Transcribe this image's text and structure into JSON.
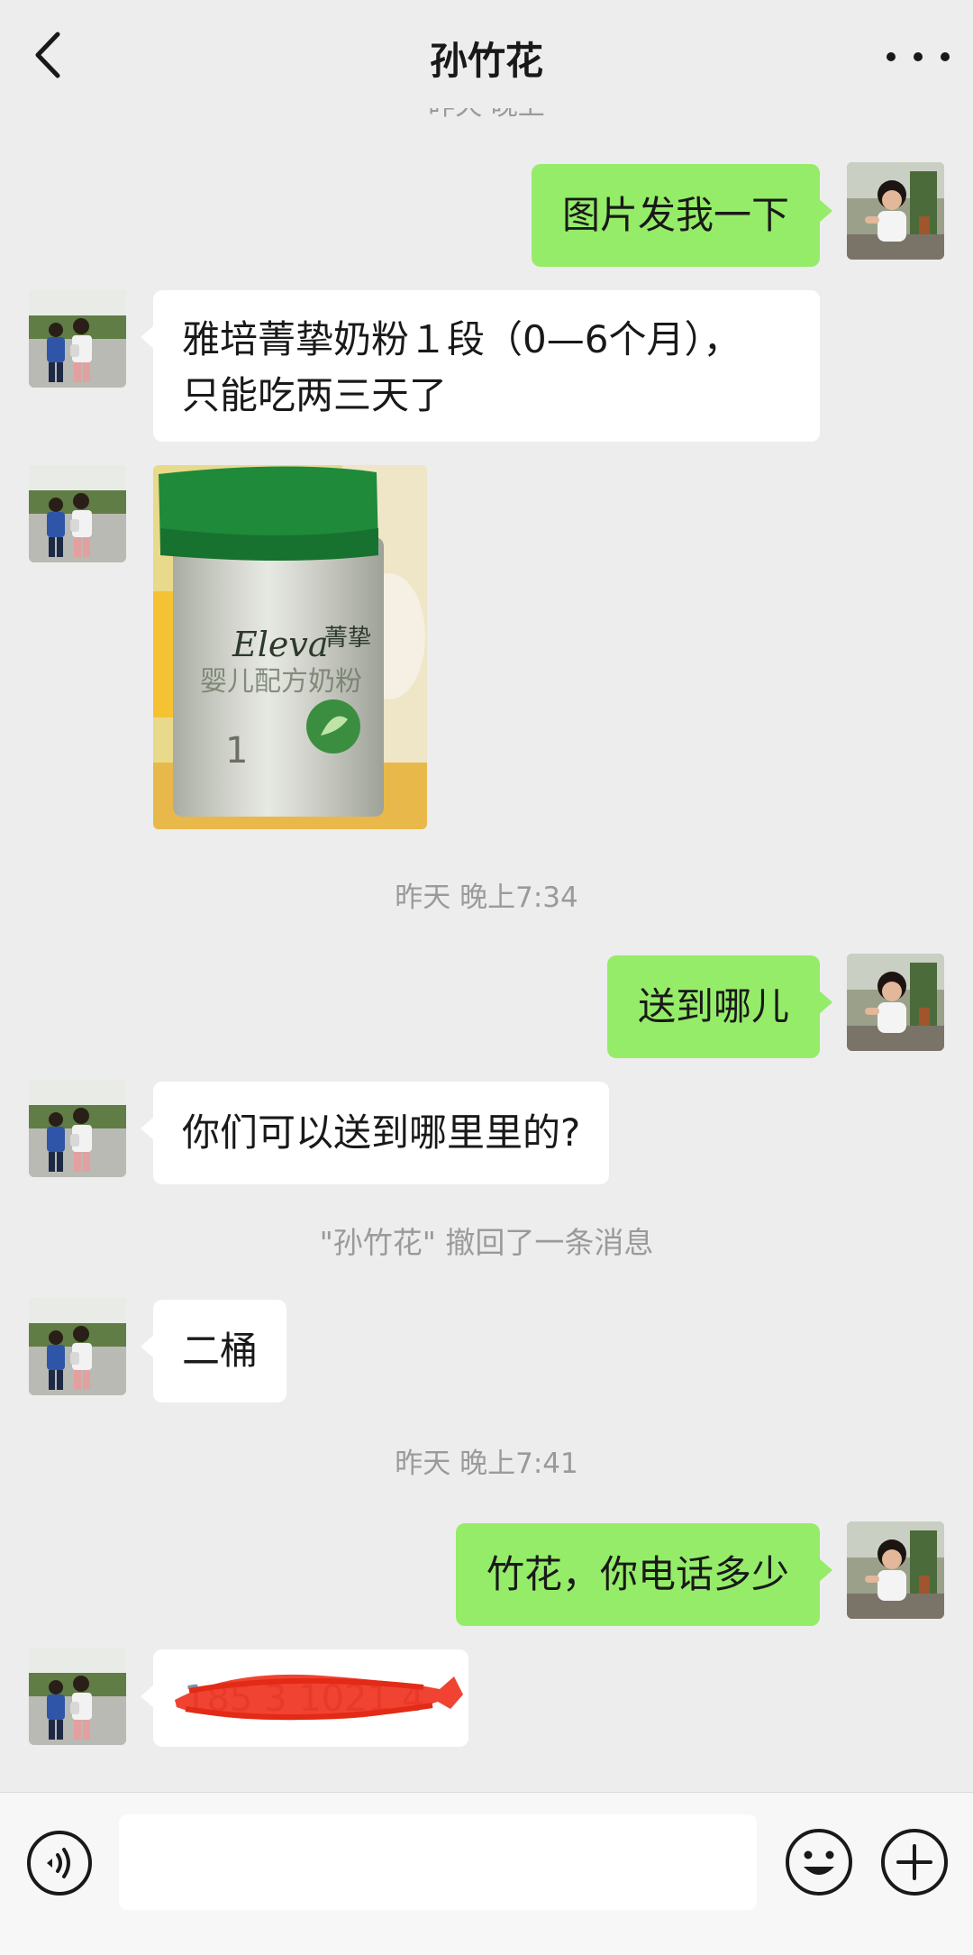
{
  "header": {
    "title": "孙竹花",
    "back_icon": "chevron-left-icon",
    "more_icon": "more-dots-icon",
    "clipped_timestamp": "昨天 晚上"
  },
  "messages": [
    {
      "side": "out",
      "type": "text",
      "text": "图片发我一下"
    },
    {
      "side": "in",
      "type": "text",
      "lines": [
        "雅培菁挚奶粉１段（0—6个月），",
        "只能吃两三天了"
      ]
    },
    {
      "side": "in",
      "type": "image",
      "product_brand": "Eleva",
      "product_name": "菁挚",
      "product_subtitle": "婴儿配方奶粉"
    },
    {
      "type": "timestamp",
      "text": "昨天 晚上7:34"
    },
    {
      "side": "out",
      "type": "text",
      "text": "送到哪儿"
    },
    {
      "side": "in",
      "type": "text",
      "text": "你们可以送到哪里里的?"
    },
    {
      "type": "system",
      "text": "\"孙竹花\" 撤回了一条消息"
    },
    {
      "side": "in",
      "type": "text",
      "text": "二桶"
    },
    {
      "type": "timestamp",
      "text": "昨天 晚上7:41"
    },
    {
      "side": "out",
      "type": "text",
      "text": "竹花，你电话多少"
    },
    {
      "side": "in",
      "type": "redacted",
      "text": "185 3 1021 4"
    }
  ],
  "bottom_bar": {
    "voice_icon": "voice-icon",
    "input_value": "",
    "emoji_icon": "emoji-icon",
    "plus_icon": "plus-icon"
  },
  "colors": {
    "background": "#ededed",
    "bubble_out": "#95ec69",
    "bubble_in": "#ffffff",
    "timestamp": "#9a9a9a",
    "redaction": "#f0331f"
  }
}
